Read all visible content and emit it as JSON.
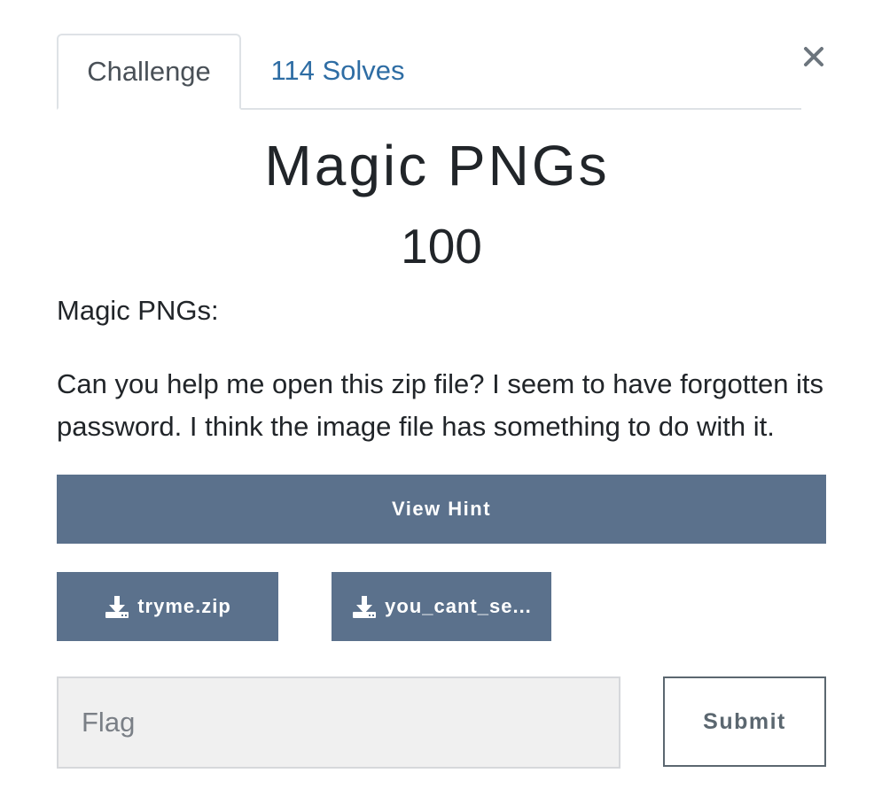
{
  "tabs": [
    {
      "label": "Challenge",
      "active": true
    },
    {
      "label": "114 Solves",
      "active": false
    }
  ],
  "challenge": {
    "name": "Magic PNGs",
    "points": "100",
    "description_heading": "Magic PNGs:",
    "description_body": "Can you help me open this zip file? I seem to have forgotten its password. I think the image file has something to do with it."
  },
  "actions": {
    "hint_label": "View Hint",
    "files": [
      {
        "label": "tryme.zip",
        "icon": "download-icon"
      },
      {
        "label": "you_cant_se...",
        "icon": "download-icon"
      }
    ],
    "flag_placeholder": "Flag",
    "submit_label": "Submit"
  },
  "colors": {
    "button_bg": "#5b718c",
    "tab_link": "#2e6da4"
  }
}
